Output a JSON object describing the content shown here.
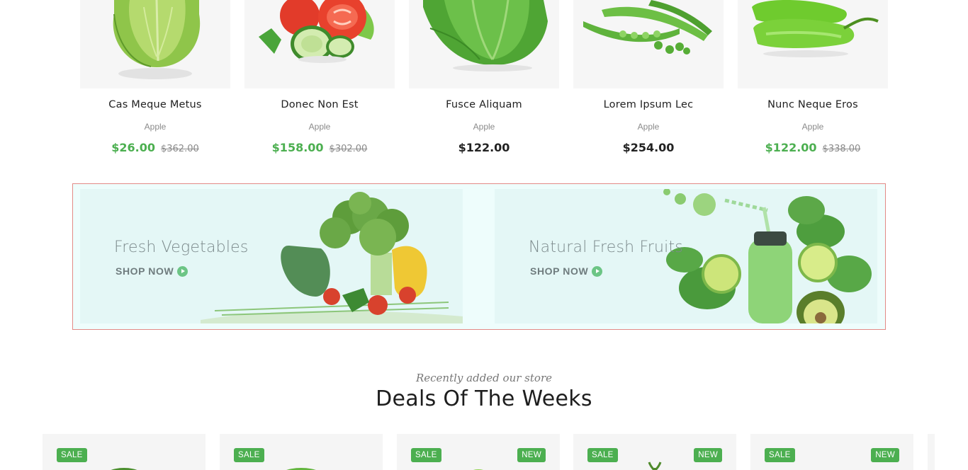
{
  "products": [
    {
      "name": "Cas Meque Metus",
      "brand": "Apple",
      "price": "$26.00",
      "old_price": "$362.00",
      "on_sale": true,
      "image": "cabbage-icon"
    },
    {
      "name": "Donec Non Est",
      "brand": "Apple",
      "price": "$158.00",
      "old_price": "$302.00",
      "on_sale": true,
      "image": "tomato-cucumber-icon"
    },
    {
      "name": "Fusce Aliquam",
      "brand": "Apple",
      "price": "$122.00",
      "old_price": "",
      "on_sale": false,
      "image": "lettuce-icon"
    },
    {
      "name": "Lorem Ipsum Lec",
      "brand": "Apple",
      "price": "$254.00",
      "old_price": "",
      "on_sale": false,
      "image": "peas-icon"
    },
    {
      "name": "Nunc Neque Eros",
      "brand": "Apple",
      "price": "$122.00",
      "old_price": "$338.00",
      "on_sale": true,
      "image": "green-pepper-icon"
    }
  ],
  "banners": [
    {
      "title": "Fresh Vegetables",
      "cta": "SHOP NOW",
      "image": "broccoli-peppers-icon"
    },
    {
      "title": "Natural Fresh Fruits",
      "cta": "SHOP NOW",
      "image": "smoothie-lime-icon"
    }
  ],
  "deals_section": {
    "subtitle": "Recently added our store",
    "title": "Deals Of The Weeks"
  },
  "deals": [
    {
      "badges": [
        "SALE"
      ]
    },
    {
      "badges": [
        "SALE"
      ]
    },
    {
      "badges": [
        "SALE",
        "NEW"
      ]
    },
    {
      "badges": [
        "SALE",
        "NEW"
      ]
    },
    {
      "badges": [
        "SALE",
        "NEW"
      ]
    }
  ],
  "colors": {
    "accent": "#4caf50",
    "banner_bg": "#e4f7f6",
    "banner_frame": "#e28a86",
    "thumb_bg": "#f6f6f6"
  }
}
